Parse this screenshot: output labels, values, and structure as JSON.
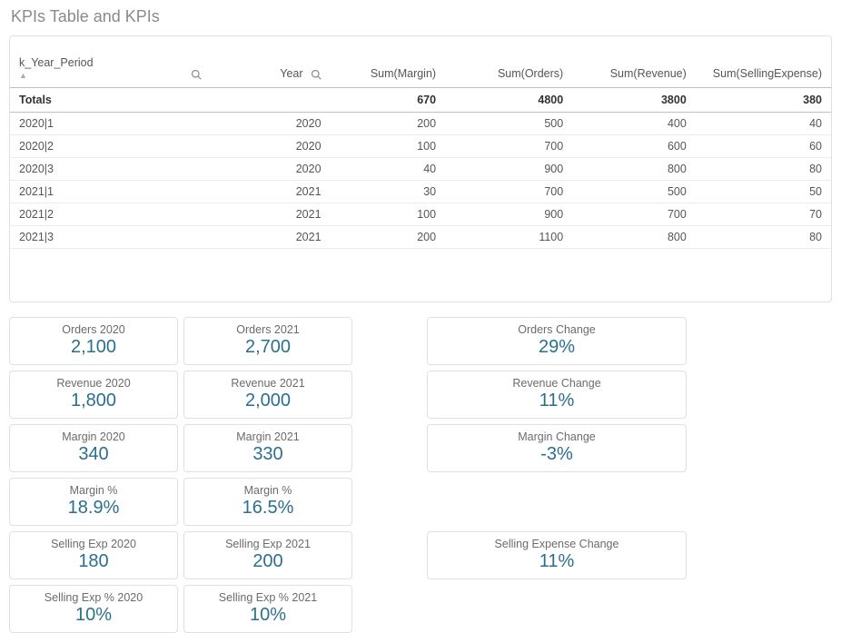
{
  "title": "KPIs Table and KPIs",
  "table": {
    "headers": {
      "period": "k_Year_Period",
      "year": "Year",
      "margin": "Sum(Margin)",
      "orders": "Sum(Orders)",
      "revenue": "Sum(Revenue)",
      "sellingExpense": "Sum(SellingExpense)"
    },
    "totals": {
      "label": "Totals",
      "year": "",
      "margin": "670",
      "orders": "4800",
      "revenue": "3800",
      "sellingExpense": "380"
    },
    "rows": [
      {
        "period": "2020|1",
        "year": "2020",
        "margin": "200",
        "orders": "500",
        "revenue": "400",
        "sellingExpense": "40"
      },
      {
        "period": "2020|2",
        "year": "2020",
        "margin": "100",
        "orders": "700",
        "revenue": "600",
        "sellingExpense": "60"
      },
      {
        "period": "2020|3",
        "year": "2020",
        "margin": "40",
        "orders": "900",
        "revenue": "800",
        "sellingExpense": "80"
      },
      {
        "period": "2021|1",
        "year": "2021",
        "margin": "30",
        "orders": "700",
        "revenue": "500",
        "sellingExpense": "50"
      },
      {
        "period": "2021|2",
        "year": "2021",
        "margin": "100",
        "orders": "900",
        "revenue": "700",
        "sellingExpense": "70"
      },
      {
        "period": "2021|3",
        "year": "2021",
        "margin": "200",
        "orders": "1100",
        "revenue": "800",
        "sellingExpense": "80"
      }
    ]
  },
  "kpis": [
    [
      {
        "title": "Orders 2020",
        "value": "2,100"
      },
      {
        "title": "Orders 2021",
        "value": "2,700"
      },
      null,
      {
        "title": "Orders Change",
        "value": "29%"
      }
    ],
    [
      {
        "title": "Revenue 2020",
        "value": "1,800"
      },
      {
        "title": "Revenue 2021",
        "value": "2,000"
      },
      null,
      {
        "title": "Revenue Change",
        "value": "11%"
      }
    ],
    [
      {
        "title": "Margin 2020",
        "value": "340"
      },
      {
        "title": "Margin 2021",
        "value": "330"
      },
      null,
      {
        "title": "Margin Change",
        "value": "-3%"
      }
    ],
    [
      {
        "title": "Margin %",
        "value": "18.9%"
      },
      {
        "title": "Margin %",
        "value": "16.5%"
      },
      null,
      null
    ],
    [
      {
        "title": "Selling Exp 2020",
        "value": "180"
      },
      {
        "title": "Selling Exp 2021",
        "value": "200"
      },
      null,
      {
        "title": "Selling Expense Change",
        "value": "11%"
      }
    ],
    [
      {
        "title": "Selling Exp % 2020",
        "value": "10%"
      },
      {
        "title": "Selling Exp % 2021",
        "value": "10%"
      },
      null,
      null
    ]
  ]
}
